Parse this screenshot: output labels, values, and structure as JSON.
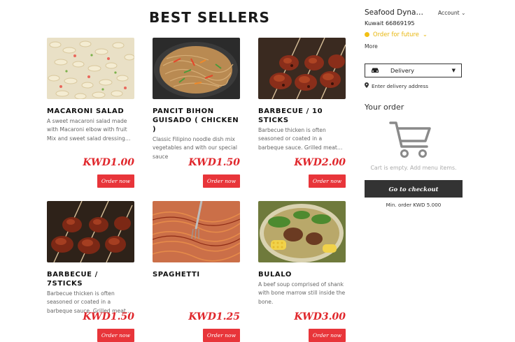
{
  "section_title": "BEST SELLERS",
  "products": [
    {
      "name": "MACARONI SALAD",
      "description": "A sweet macaroni salad made with Macaroni elbow with fruit Mix and sweet salad dressing…",
      "price": "KWD1.00",
      "order_label": "Order now",
      "image": "macaroni-salad-photo"
    },
    {
      "name": "PANCIT BIHON GUISADO ( CHICKEN )",
      "description": "Classic Filipino noodle dish mix vegetables and with our special sauce",
      "price": "KWD1.50",
      "order_label": "Order now",
      "image": "pancit-bihon-photo"
    },
    {
      "name": "BARBECUE / 10 STICKS",
      "description": "Barbecue thicken is often seasoned or coated in a barbeque sauce. Grilled meat…",
      "price": "KWD2.00",
      "order_label": "Order now",
      "image": "barbecue-photo"
    },
    {
      "name": "BARBECUE / 7STICKS",
      "description": "Barbecue thicken is often seasoned or coated in a barbeque sauce. Grilled meat…",
      "price": "KWD1.50",
      "order_label": "Order now",
      "image": "barbecue-photo"
    },
    {
      "name": "SPAGHETTI",
      "description": "",
      "price": "KWD1.25",
      "order_label": "Order now",
      "image": "spaghetti-photo"
    },
    {
      "name": "BULALO",
      "description": "A beef soup comprised of shank with bone marrow still inside the bone.",
      "price": "KWD3.00",
      "order_label": "Order now",
      "image": "bulalo-photo"
    }
  ],
  "sidebar": {
    "restaurant_name": "Seafood Dyna…",
    "phone": "Kuwait 66869195",
    "account_label": "Account",
    "status_label": "Order for future",
    "more_label": "More",
    "delivery_label": "Delivery",
    "address_label": "Enter delivery address",
    "your_order": "Your order",
    "cart_empty": "Cart is empty. Add menu items.",
    "checkout_label": "Go to checkout",
    "min_order": "Min. order KWD 5.000",
    "icons": [
      "car-icon",
      "caret-down-icon",
      "location-pin-icon",
      "cart-icon",
      "chevron-down-icon"
    ]
  },
  "colors": {
    "accent": "#e8353a",
    "status": "#f2c014",
    "checkout": "#333333"
  }
}
